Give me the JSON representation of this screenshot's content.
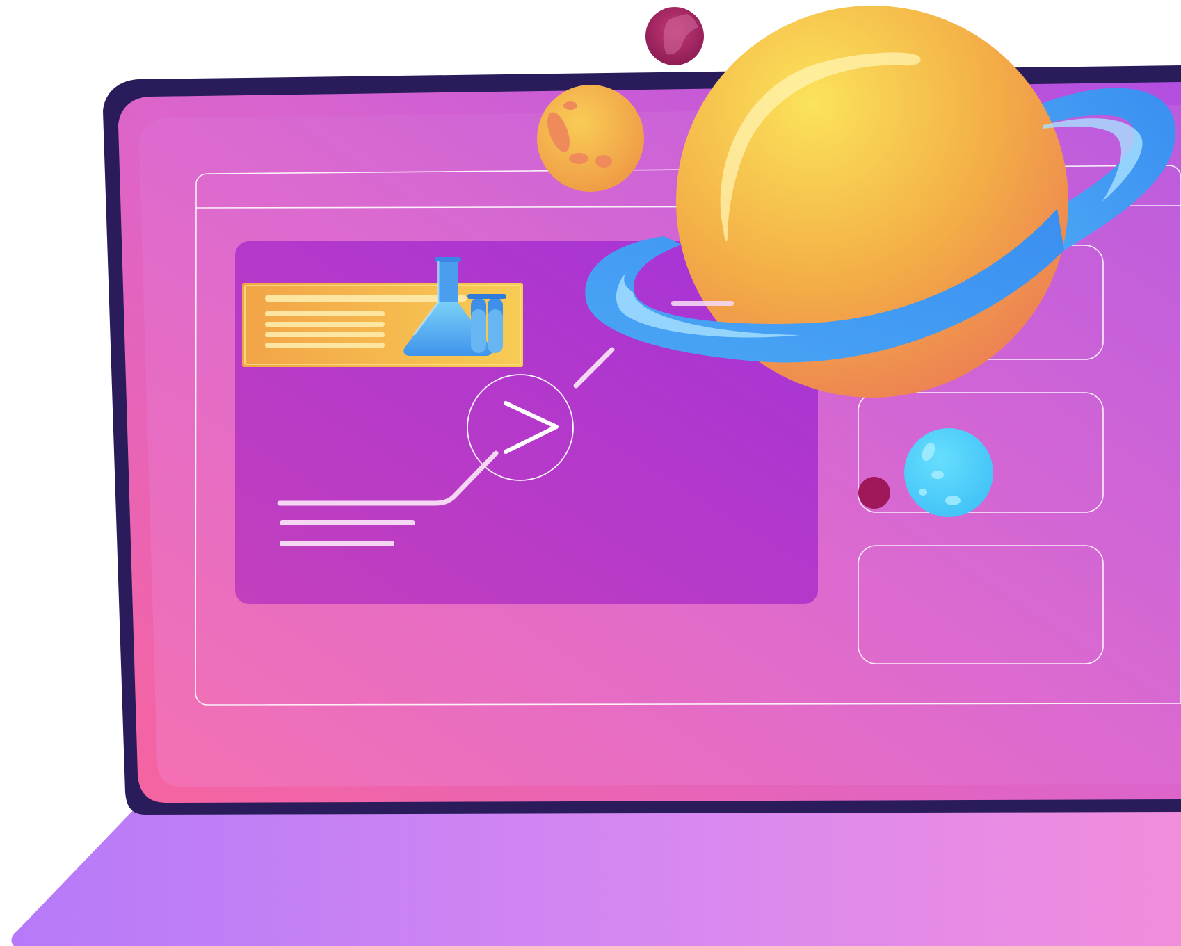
{
  "scene": {
    "description_kind": "illustration",
    "palette": {
      "bezel_dark": "#2a1c5a",
      "screen_pink": "#ee5a9a",
      "screen_purple": "#b04be0",
      "inner_panel": "#b83cc8",
      "card_orange": "#f3a54a",
      "card_yellow": "#f6d35a",
      "planet_yellow": "#f8dc55",
      "planet_orange": "#f0a445",
      "ring_blue": "#3f9cf3",
      "ring_light": "#8fd7ff",
      "bubble_blue": "#4fd3fb",
      "small_dot": "#a0185a",
      "keyboard_left": "#b87cf7",
      "keyboard_right": "#f07fd8",
      "line_white": "#ffffff"
    },
    "icons": {
      "play": "play-icon",
      "flask": "flask-icon",
      "test_tubes": "test-tubes-icon",
      "planet": "ringed-planet-icon",
      "moon": "moon-icon",
      "small_planet": "small-planet-icon",
      "bubble": "bubble-planet-icon"
    }
  }
}
